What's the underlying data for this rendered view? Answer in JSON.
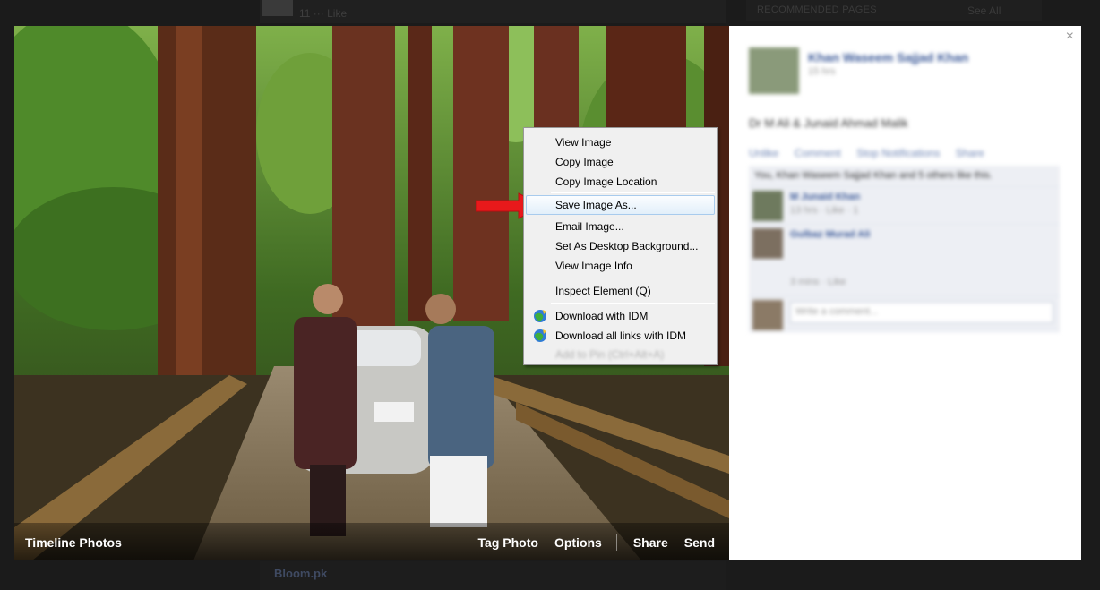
{
  "background": {
    "post_likes": "11 ··· Like",
    "recommended_title": "RECOMMENDED PAGES",
    "see_all": "See All",
    "bottom_post_title": "Bloom.pk"
  },
  "photo_bar": {
    "album": "Timeline Photos",
    "tag_photo": "Tag Photo",
    "options": "Options",
    "share": "Share",
    "send": "Send"
  },
  "side": {
    "close": "×",
    "name": "Khan Waseem Sajjad Khan",
    "time": "15 hrs",
    "caption": "Dr M Ali & Junaid Ahmad Malik",
    "links": [
      "Unlike",
      "Comment",
      "Stop Notifications",
      "Share"
    ],
    "likes_text": "You, Khan Waseem Sajjad Khan and 5 others like this.",
    "comment1_name": "M Junaid Khan",
    "comment1_text": "13 hrs · Like · 1",
    "comment2_name": "Gulbaz Murad Ali",
    "comment2_text": "3 mins · Like",
    "write_placeholder": "Write a comment..."
  },
  "context_menu": {
    "items": [
      "View Image",
      "Copy Image",
      "Copy Image Location",
      "Save Image As...",
      "Email Image...",
      "Set As Desktop Background...",
      "View Image Info",
      "Inspect Element (Q)",
      "Download with IDM",
      "Download all links with IDM"
    ],
    "highlighted": "Save Image As...",
    "ghost": "Add to Pin (Ctrl+Alt+A)"
  },
  "colors": {
    "accent_arrow": "#e8191b",
    "fb_blue": "#3b5998",
    "menu_highlight": "#a8cbed"
  }
}
